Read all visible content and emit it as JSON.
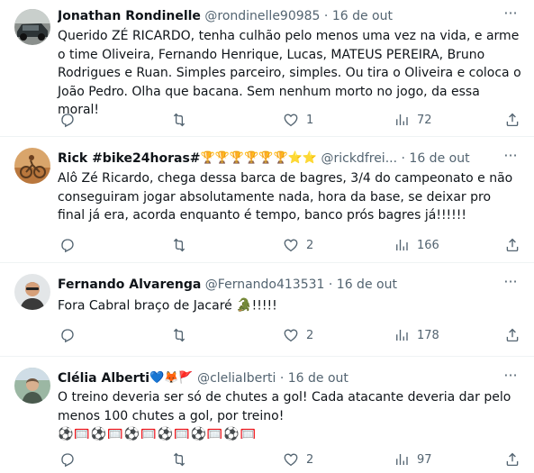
{
  "tweets": [
    {
      "name": "Jonathan Rondinelle",
      "handle": "@rondinelle90985",
      "separator": "·",
      "date": "16 de out",
      "more": "···",
      "text": "Querido ZÉ RICARDO, tenha culhão pelo menos uma vez na vida, e arme o time Oliveira, Fernando Henrique, Lucas, MATEUS PEREIRA, Bruno Rodrigues e Ruan. Simples parceiro, simples. Ou tira o Oliveira e coloca o João Pedro. Olha que bacana. Sem nenhum morto no jogo, da essa moral!",
      "likes": "1",
      "views": "72"
    },
    {
      "name": "Rick #bike24horas#",
      "name_emojis": "🏆🏆🏆🏆🏆🏆⭐⭐",
      "handle": "@rickdfrei...",
      "separator": "·",
      "date": "16 de out",
      "more": "···",
      "text": "Alô Zé Ricardo, chega dessa barca de bagres, 3/4 do campeonato e não conseguiram jogar absolutamente nada, hora da base, se deixar pro final já era, acorda enquanto é tempo, banco prós bagres já!!!!!!",
      "likes": "2",
      "views": "166"
    },
    {
      "name": "Fernando Alvarenga",
      "handle": "@Fernando413531",
      "separator": "·",
      "date": "16 de out",
      "more": "···",
      "text_before": "Fora Cabral braço de Jacaré ",
      "text_emoji": "🐊",
      "text_after": "!!!!!",
      "likes": "2",
      "views": "178"
    },
    {
      "name": "Clélia Alberti",
      "name_emojis": "💙🦊🚩",
      "handle": "@cleliaIberti",
      "separator": "·",
      "date": "16 de out",
      "more": "···",
      "text": "O treino deveria ser só de chutes a gol! Cada atacante deveria dar pelo menos 100 chutes a gol, por treino!",
      "text_emojis": "⚽🥅⚽🥅⚽🥅⚽🥅⚽🥅⚽🥅",
      "likes": "2",
      "views": "97"
    }
  ],
  "icons": {
    "reply": "reply-icon",
    "retweet": "retweet-icon",
    "like": "heart-icon",
    "views": "views-icon",
    "share": "share-icon"
  }
}
